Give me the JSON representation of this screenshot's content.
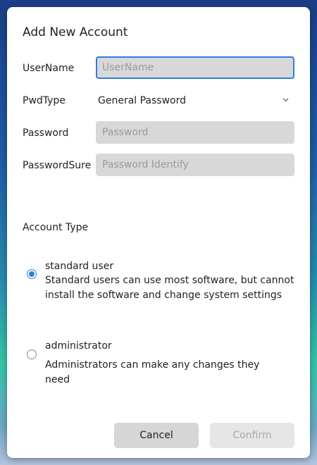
{
  "dialog": {
    "title": "Add New Account",
    "username_label": "UserName",
    "username_placeholder": "UserName",
    "pwdtype_label": "PwdType",
    "pwdtype_value": "General Password",
    "password_label": "Password",
    "password_placeholder": "Password",
    "passwordsure_label": "PasswordSure",
    "passwordsure_placeholder": "Password Identify",
    "account_type_label": "Account Type",
    "options": [
      {
        "title": "standard user",
        "description": "Standard users can use most software, but cannot install the software and change system settings",
        "selected": true
      },
      {
        "title": "administrator",
        "description": "Administrators can make any changes they need",
        "selected": false
      }
    ],
    "cancel_label": "Cancel",
    "confirm_label": "Confirm"
  },
  "colors": {
    "accent": "#2f7fdc",
    "input_bg": "#d8d8d8",
    "disabled_text": "#a8a8a8"
  },
  "icons": {
    "select_arrow": "chevron-down-icon"
  }
}
